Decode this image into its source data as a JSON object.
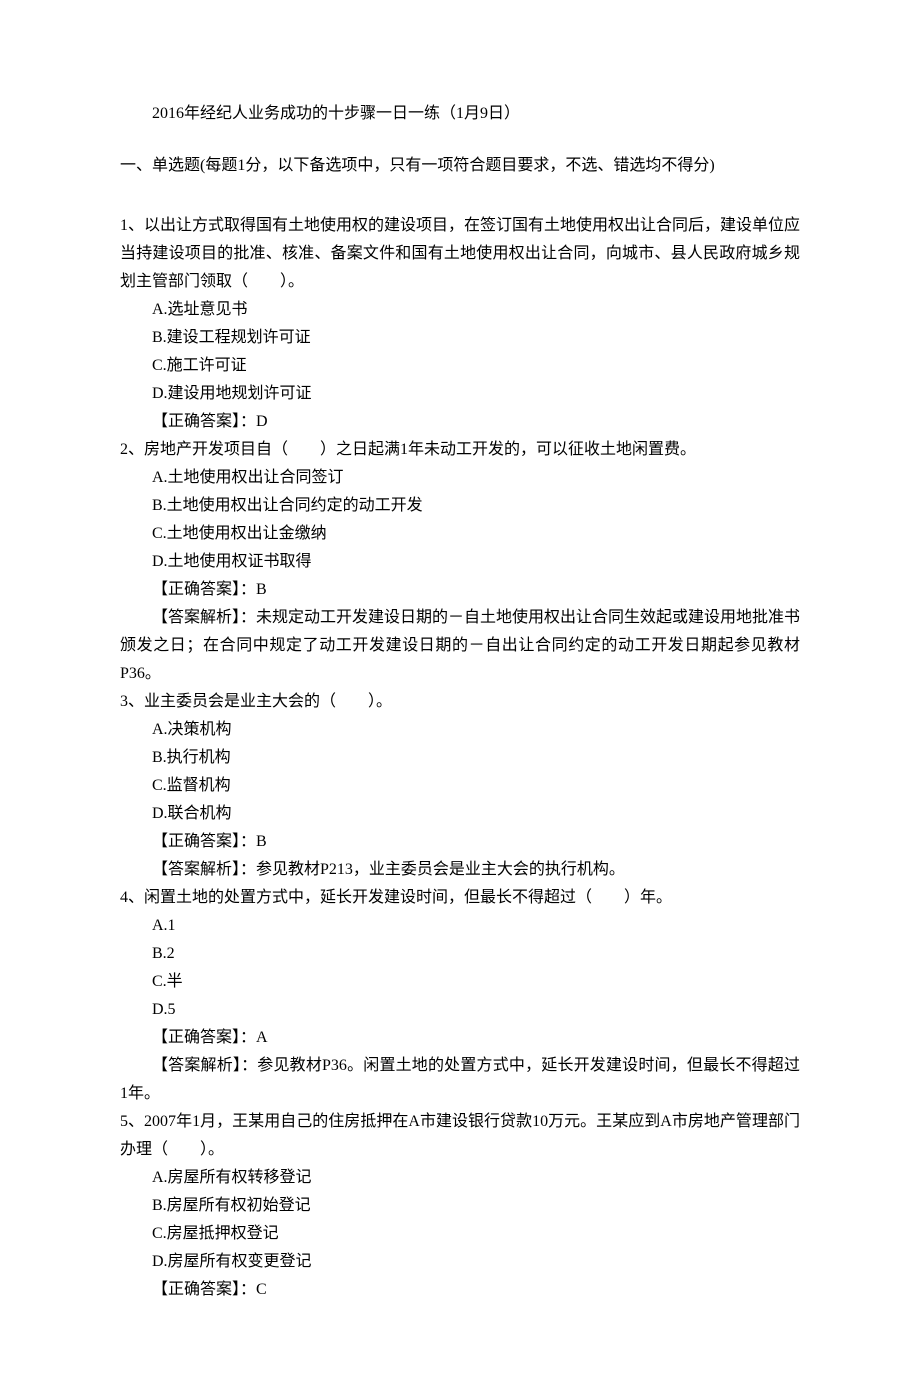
{
  "title": "2016年经纪人业务成功的十步骤一日一练（1月9日）",
  "section_header": "一、单选题(每题1分，以下备选项中，只有一项符合题目要求，不选、错选均不得分)",
  "questions": [
    {
      "stem": "1、以出让方式取得国有土地使用权的建设项目，在签订国有土地使用权出让合同后，建设单位应当持建设项目的批准、核准、备案文件和国有土地使用权出让合同，向城市、县人民政府城乡规划主管部门领取（　　）。",
      "options": [
        "A.选址意见书",
        "B.建设工程规划许可证",
        "C.施工许可证",
        "D.建设用地规划许可证"
      ],
      "answer": "【正确答案】：D",
      "analysis": ""
    },
    {
      "stem": "2、房地产开发项目自（　　）之日起满1年未动工开发的，可以征收土地闲置费。",
      "options": [
        "A.土地使用权出让合同签订",
        "B.土地使用权出让合同约定的动工开发",
        "C.土地使用权出让金缴纳",
        "D.土地使用权证书取得"
      ],
      "answer": "【正确答案】：B",
      "analysis": "【答案解析】：未规定动工开发建设日期的－自土地使用权出让合同生效起或建设用地批准书颁发之日；在合同中规定了动工开发建设日期的－自出让合同约定的动工开发日期起参见教材P36。"
    },
    {
      "stem": "3、业主委员会是业主大会的（　　）。",
      "options": [
        "A.决策机构",
        "B.执行机构",
        "C.监督机构",
        "D.联合机构"
      ],
      "answer": "【正确答案】：B",
      "analysis": "【答案解析】：参见教材P213，业主委员会是业主大会的执行机构。"
    },
    {
      "stem": "4、闲置土地的处置方式中，延长开发建设时间，但最长不得超过（　　）年。",
      "options": [
        "A.1",
        "B.2",
        "C.半",
        "D.5"
      ],
      "answer": "【正确答案】：A",
      "analysis": "【答案解析】：参见教材P36。闲置土地的处置方式中，延长开发建设时间，但最长不得超过1年。"
    },
    {
      "stem": "5、2007年1月，王某用自己的住房抵押在A市建设银行贷款10万元。王某应到A市房地产管理部门办理（　　）。",
      "options": [
        "A.房屋所有权转移登记",
        "B.房屋所有权初始登记",
        "C.房屋抵押权登记",
        "D.房屋所有权变更登记"
      ],
      "answer": "【正确答案】：C",
      "analysis": ""
    }
  ]
}
